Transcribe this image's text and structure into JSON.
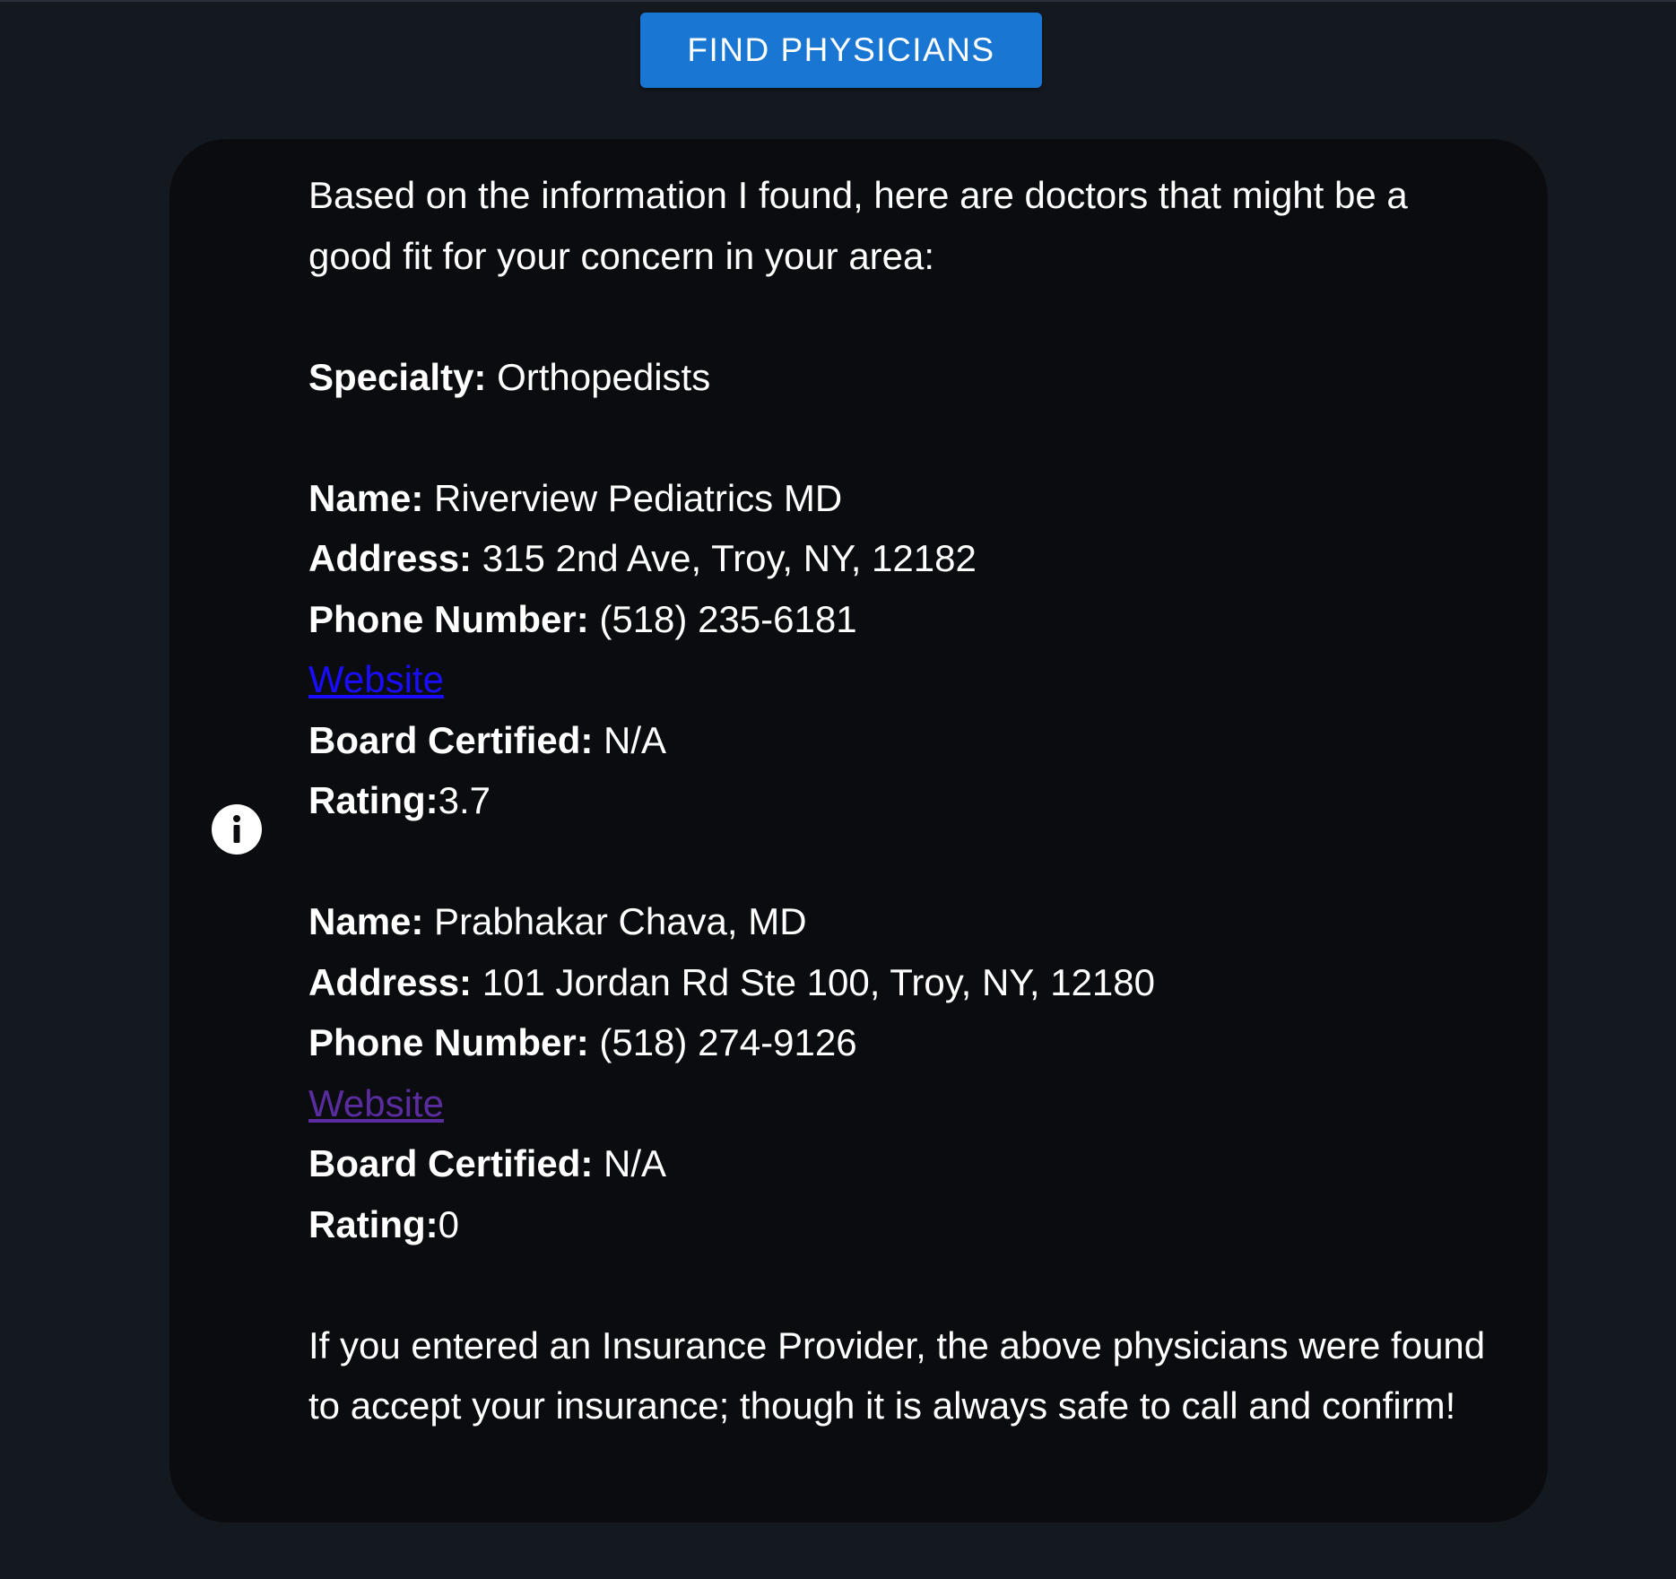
{
  "find_button": {
    "label": "FIND PHYSICIANS"
  },
  "message": {
    "intro": "Based on the information I found, here are doctors that might be a good fit for your concern in your area:",
    "specialty_label": "Specialty:",
    "specialty_value": " Orthopedists",
    "physicians": [
      {
        "name_label": "Name:",
        "name": " Riverview Pediatrics MD",
        "address_label": "Address:",
        "address": " 315 2nd Ave, Troy, NY, 12182",
        "phone_label": "Phone Number:",
        "phone": " (518) 235-6181",
        "website_label": "Website",
        "board_label": "Board Certified:",
        "board": " N/A",
        "rating_label": "Rating:",
        "rating": "3.7"
      },
      {
        "name_label": "Name:",
        "name": " Prabhakar Chava, MD",
        "address_label": "Address:",
        "address": " 101 Jordan Rd Ste 100, Troy, NY, 12180",
        "phone_label": "Phone Number:",
        "phone": " (518) 274-9126",
        "website_label": "Website",
        "board_label": "Board Certified:",
        "board": " N/A",
        "rating_label": "Rating:",
        "rating": "0"
      }
    ],
    "closing": "If you entered an Insurance Provider, the above physicians were found to accept your insurance; though it is always safe to call and confirm!"
  },
  "icons": {
    "info": "info-icon"
  },
  "colors": {
    "page_background": "#141920",
    "card_background": "#0b0c10",
    "button": "#1976d2",
    "link_unvisited": "#1a0dff",
    "link_visited": "#5a2ca0"
  }
}
